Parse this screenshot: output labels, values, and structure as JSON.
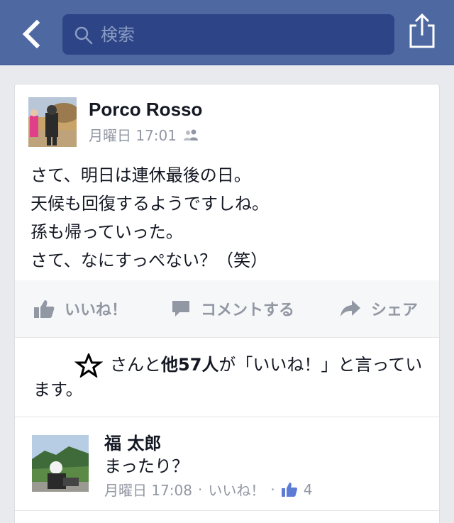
{
  "nav": {
    "search_placeholder": "検索",
    "bar_color": "#4e69a2",
    "search_bg": "#2d4486"
  },
  "post": {
    "author": "Porco Rosso",
    "time": "月曜日 17:01",
    "audience_icon": "friends-icon",
    "lines": [
      "さて、明日は連休最後の日。",
      "天候も回復するようですしね。",
      "孫も帰っていった。",
      "さて、なにすっぺない？（笑）"
    ]
  },
  "actions": {
    "like": "いいね！",
    "comment": "コメントする",
    "share": "シェア"
  },
  "likes_summary": {
    "prefix": "さんと",
    "others": "他57人",
    "suffix": "が「いいね！」と言っています。"
  },
  "comment": {
    "author": "福 太郎",
    "text": "まったり？",
    "time": "月曜日 17:08",
    "separator": "·",
    "like_label": "いいね！",
    "like_count": "4"
  },
  "colors": {
    "meta_gray": "#9197a3",
    "text": "#141823",
    "like_blue": "#5b7bd5"
  }
}
